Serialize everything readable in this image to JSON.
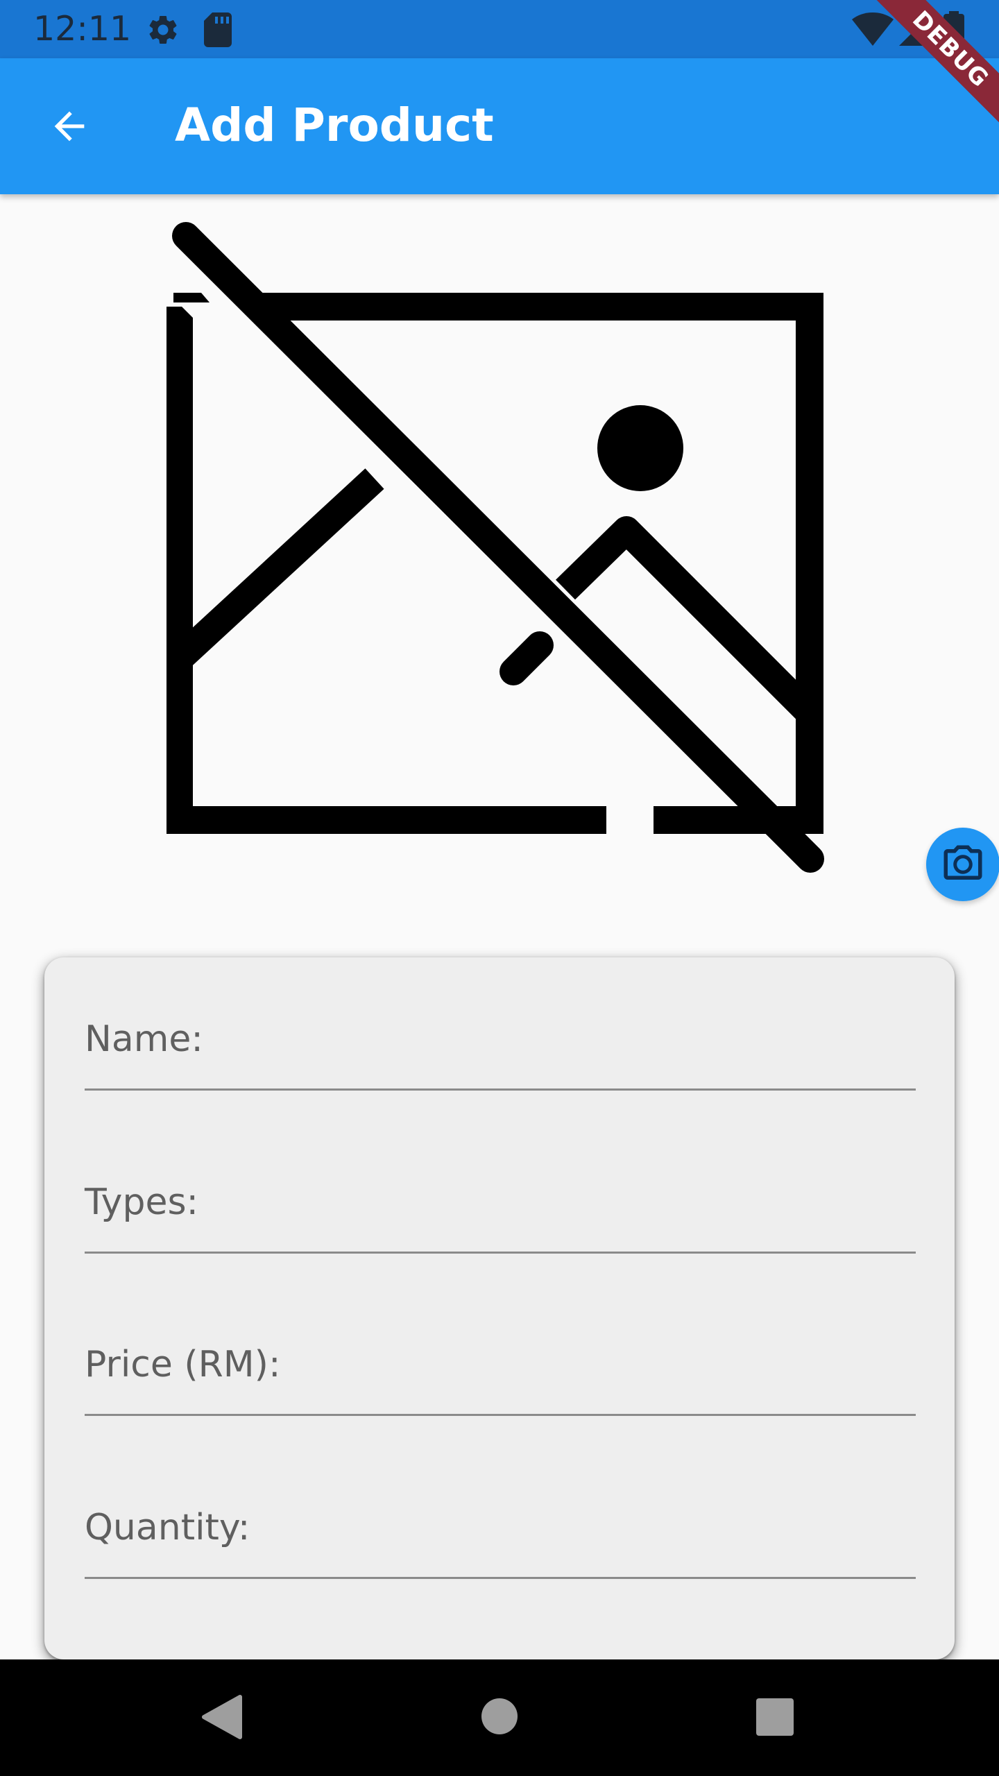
{
  "status_bar": {
    "time": "12:11",
    "icons": [
      "gear-icon",
      "sd-card-icon",
      "wifi-icon",
      "signal-icon",
      "battery-icon"
    ],
    "background": "#1976d2"
  },
  "debug_banner": {
    "label": "DEBUG",
    "color": "#8a2838"
  },
  "app_bar": {
    "title": "Add Product",
    "back_icon": "arrow-back-icon",
    "background": "#2196f3"
  },
  "product_image": {
    "icon": "image-not-supported-icon"
  },
  "camera_button": {
    "icon": "camera-icon",
    "background": "#2196f3"
  },
  "form": {
    "fields": [
      {
        "label": "Name:",
        "value": ""
      },
      {
        "label": "Types:",
        "value": ""
      },
      {
        "label": "Price (RM):",
        "value": ""
      },
      {
        "label": "Quantity:",
        "value": ""
      }
    ]
  },
  "nav_bar": {
    "icons": [
      "nav-back-icon",
      "nav-home-icon",
      "nav-recents-icon"
    ]
  }
}
